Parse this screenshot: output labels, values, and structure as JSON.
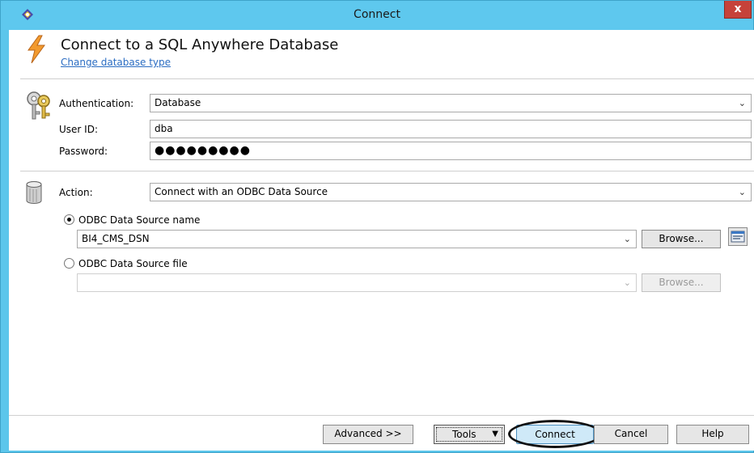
{
  "window": {
    "title": "Connect",
    "close_label": "x"
  },
  "header": {
    "title": "Connect to a SQL Anywhere Database",
    "link": "Change database type"
  },
  "auth": {
    "authentication_label": "Authentication:",
    "authentication_value": "Database",
    "userid_label": "User ID:",
    "userid_value": "dba",
    "password_label": "Password:",
    "password_value": "●●●●●●●●●"
  },
  "action": {
    "label": "Action:",
    "value": "Connect with an ODBC Data Source",
    "odbc_name_label": "ODBC Data Source name",
    "odbc_name_value": "BI4_CMS_DSN",
    "odbc_name_selected": true,
    "browse_label": "Browse...",
    "odbc_file_label": "ODBC Data Source file",
    "odbc_file_value": "",
    "browse_file_label": "Browse..."
  },
  "footer": {
    "advanced_label": "Advanced >>",
    "tools_label": "Tools",
    "connect_label": "Connect",
    "cancel_label": "Cancel",
    "help_label": "Help"
  },
  "colors": {
    "titlebar": "#5ec8ee",
    "close": "#c6423a",
    "link": "#2a6cc2",
    "connect_button": "#cfe9f8"
  },
  "icons": {
    "app": "sql-anywhere-icon",
    "header": "lightning-bolt-icon",
    "auth": "keys-icon",
    "action": "database-cylinder-icon",
    "odbc_admin": "odbc-administrator-icon"
  }
}
